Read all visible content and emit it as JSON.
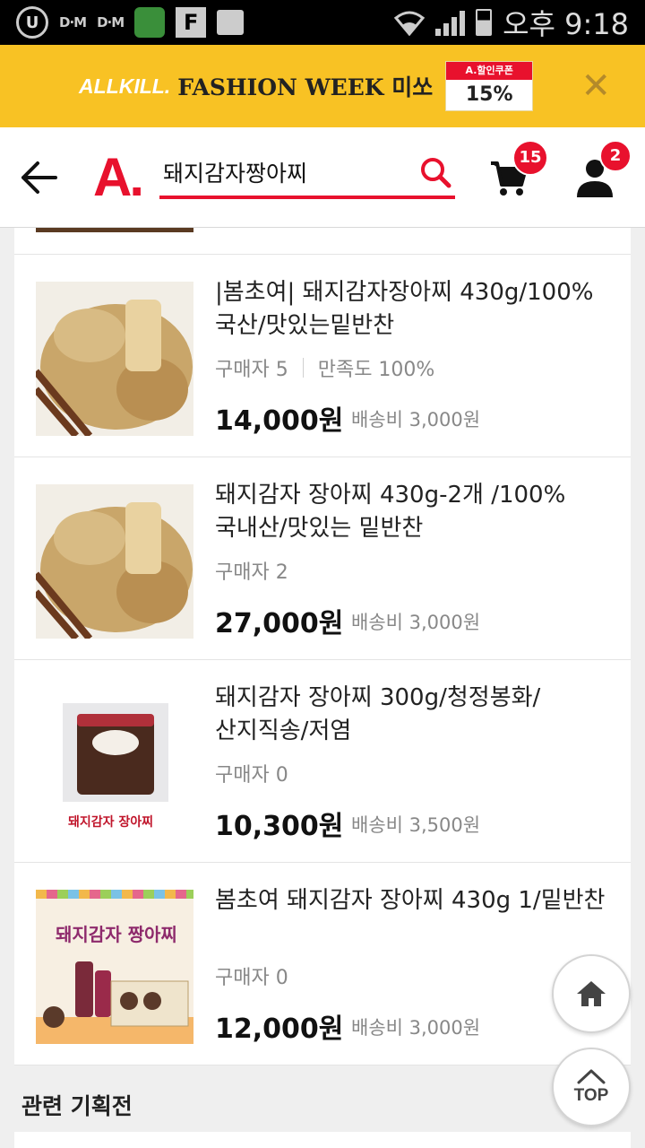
{
  "status_bar": {
    "daum1": "D·M",
    "daum2": "D·M",
    "f_icon": "F",
    "time": "오후 9:18"
  },
  "banner": {
    "brand": "ALLKILL.",
    "text": "FASHION WEEK 미쏘",
    "coupon_top": "A.할인쿠폰",
    "coupon_pct": "15%",
    "close": "✕"
  },
  "header": {
    "logo": "A.",
    "search_value": "돼지감자짱아찌",
    "cart_count": "15",
    "user_count": "2"
  },
  "products": [
    {
      "title": "|봄초여| 돼지감자장아찌 430g/100%국산/맛있는밑반찬",
      "buyers": "구매자 5",
      "satisfaction": "만족도 100%",
      "price": "14,000원",
      "shipping": "배송비 3,000원"
    },
    {
      "title": "돼지감자 장아찌 430g-2개 /100%국내산/맛있는 밑반찬",
      "buyers": "구매자 2",
      "price": "27,000원",
      "shipping": "배송비 3,000원"
    },
    {
      "title": "돼지감자 장아찌 300g/청정봉화/산지직송/저염",
      "buyers": "구매자 0",
      "price": "10,300원",
      "shipping": "배송비 3,500원",
      "image_caption": "돼지감자 장아찌"
    },
    {
      "title": "봄초여 돼지감자 장아찌 430g 1/밑반찬",
      "buyers": "구매자 0",
      "price": "12,000원",
      "shipping": "배송비 3,000원",
      "image_caption": "돼지감자 짱아찌"
    }
  ],
  "related": {
    "title": "관련 기획전"
  },
  "fab": {
    "top_label": "TOP"
  }
}
